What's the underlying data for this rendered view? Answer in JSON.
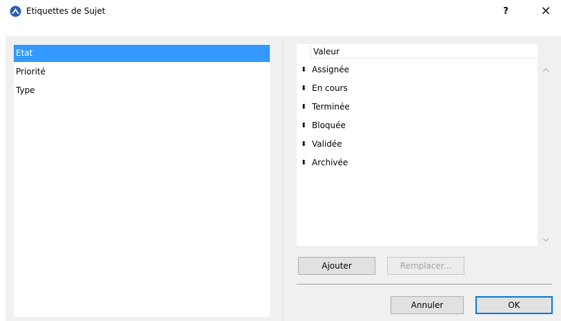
{
  "window": {
    "title": "Etiquettes de Sujet",
    "help_label": "?",
    "close_label": "✕",
    "app_icon": "archicad-icon"
  },
  "categories": [
    {
      "label": "Etat",
      "selected": true
    },
    {
      "label": "Priorité",
      "selected": false
    },
    {
      "label": "Type",
      "selected": false
    }
  ],
  "values_list": {
    "header": "Valeur",
    "drag_handle_icon": "up-down-arrow-icon",
    "rows": [
      "Assignée",
      "En cours",
      "Terminée",
      "Bloquée",
      "Validée",
      "Archivée"
    ]
  },
  "buttons": {
    "add": "Ajouter",
    "replace": "Remplacer...",
    "cancel": "Annuler",
    "ok": "OK"
  },
  "colors": {
    "selection": "#3399ff",
    "default_button_border": "#0078d7"
  }
}
